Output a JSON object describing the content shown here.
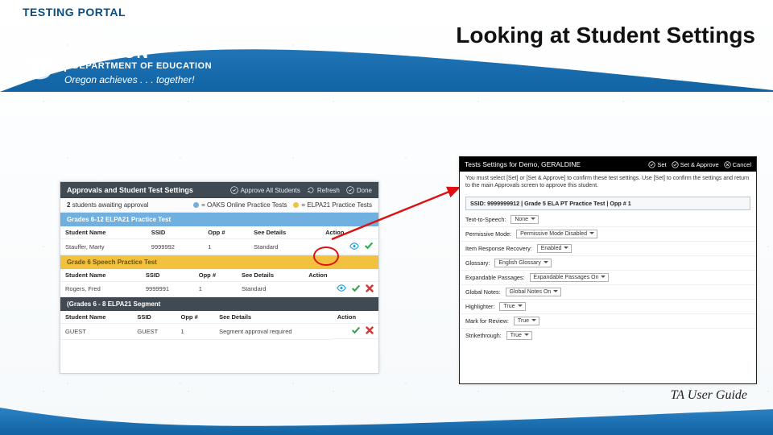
{
  "header": "TESTING PORTAL",
  "logo": {
    "oregon": "OREGON",
    "dept": "DEPARTMENT OF EDUCATION",
    "tag": "Oregon achieves . . . together!"
  },
  "title": "Looking at Student Settings",
  "footer": "TA User Guide",
  "left": {
    "barTitle": "Approvals and Student Test Settings",
    "barBtns": [
      "Approve All Students",
      "Refresh",
      "Done"
    ],
    "awaiting": {
      "count": "2",
      "label": "students awaiting approval"
    },
    "legend": [
      {
        "color": "#6fb0e0",
        "label": "OAKS Online Practice Tests"
      },
      {
        "color": "#f2c23e",
        "label": "ELPA21 Practice Tests"
      }
    ],
    "sections": [
      {
        "cls": "sectHdrA",
        "title": "Grades 6-12 ELPA21 Practice Test",
        "cols": [
          "Student Name",
          "SSID",
          "Opp #",
          "See Details",
          "Action"
        ],
        "rows": [
          {
            "name": "Stauffer, Marty",
            "ssid": "9999992",
            "opp": "1",
            "det": "Standard",
            "act": [
              "eye",
              "ck"
            ]
          }
        ]
      },
      {
        "cls": "sectHdrB",
        "title": "Grade 6 Speech Practice Test",
        "cols": [
          "Student Name",
          "SSID",
          "Opp #",
          "See Details",
          "Action"
        ],
        "rows": [
          {
            "name": "Rogers, Fred",
            "ssid": "9999991",
            "opp": "1",
            "det": "Standard",
            "act": [
              "eye",
              "ck",
              "x"
            ]
          }
        ]
      },
      {
        "cls": "sectHdrC",
        "title": "(Grades 6 - 8 ELPA21 Segment",
        "cols": [
          "Student Name",
          "SSID",
          "Opp #",
          "See Details",
          "Action"
        ],
        "rows": [
          {
            "name": "GUEST",
            "ssid": "GUEST",
            "opp": "1",
            "det": "Segment approval required",
            "act": [
              "ck",
              "x"
            ]
          }
        ]
      }
    ]
  },
  "right": {
    "hdr": "Tests Settings for Demo, GERALDINE",
    "hdrBtns": [
      "Set",
      "Set & Approve",
      "Cancel"
    ],
    "instr": "You must select [Set] or [Set & Approve] to confirm these test settings. Use [Set] to confirm the settings and return to the main Approvals screen to approve this student.",
    "ssid": "SSID: 9999999912 | Grade 5 ELA PT Practice Test | Opp # 1",
    "settings": [
      {
        "label": "Text-to-Speech:",
        "value": "None"
      },
      {
        "label": "Permissive Mode:",
        "value": "Permissive Mode Disabled"
      },
      {
        "label": "Item Response Recovery:",
        "value": "Enabled"
      },
      {
        "label": "Glossary:",
        "value": "English Glossary"
      },
      {
        "label": "Expandable Passages:",
        "value": "Expandable Passages On"
      },
      {
        "label": "Global Notes:",
        "value": "Global Notes On"
      },
      {
        "label": "Highlighter:",
        "value": "True"
      },
      {
        "label": "Mark for Review:",
        "value": "True"
      },
      {
        "label": "Strikethrough:",
        "value": "True"
      }
    ]
  }
}
